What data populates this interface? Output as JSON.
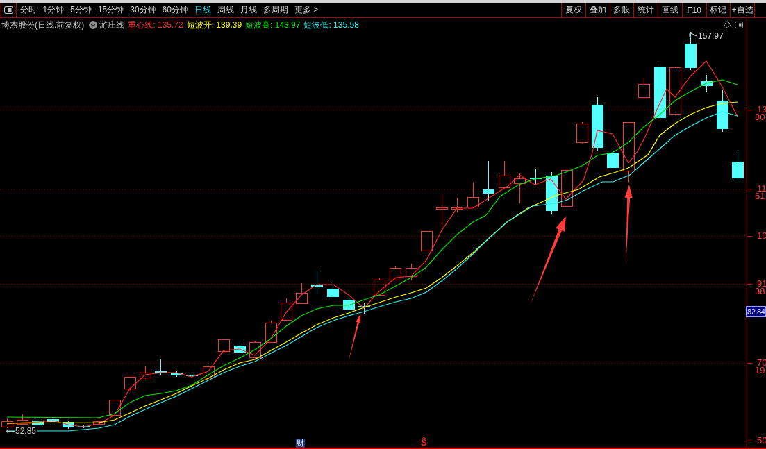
{
  "toolbar": {
    "periods": [
      {
        "label": "分时",
        "selected": false
      },
      {
        "label": "1分钟",
        "selected": false
      },
      {
        "label": "5分钟",
        "selected": false
      },
      {
        "label": "15分钟",
        "selected": false
      },
      {
        "label": "30分钟",
        "selected": false
      },
      {
        "label": "60分钟",
        "selected": false
      },
      {
        "label": "日线",
        "selected": true
      },
      {
        "label": "周线",
        "selected": false
      },
      {
        "label": "月线",
        "selected": false
      },
      {
        "label": "多周期",
        "selected": false
      },
      {
        "label": "更多 >",
        "selected": false
      }
    ],
    "buttons": [
      "复权",
      "叠加",
      "多股",
      "统计",
      "画线",
      "F10",
      "标记",
      "+自选"
    ]
  },
  "legend": {
    "title": "博杰股份(日线.前复权)",
    "indicator_set": "游庄线",
    "indicators": [
      {
        "label": "重心线: 135.72",
        "color": "#ff2a2a"
      },
      {
        "label": "短波开: 139.39",
        "color": "#ffff00"
      },
      {
        "label": "短波高: 143.97",
        "color": "#00e600"
      },
      {
        "label": "短波低: 135.58",
        "color": "#33f0f0"
      }
    ]
  },
  "chart": {
    "high_label": "157.97",
    "low_label": "52.85",
    "y_axis": [
      {
        "price": "13",
        "percent": "80."
      },
      {
        "price": "11",
        "percent": "61."
      },
      {
        "price": "10"
      },
      {
        "price": "91",
        "percent": "38."
      },
      {
        "price": "70",
        "percent": "19."
      },
      {
        "price": "50"
      }
    ],
    "current_price": "82.84",
    "markers": [
      {
        "kind": "finance",
        "text": "财"
      },
      {
        "kind": "signal",
        "text": "Ŝ"
      }
    ]
  }
}
